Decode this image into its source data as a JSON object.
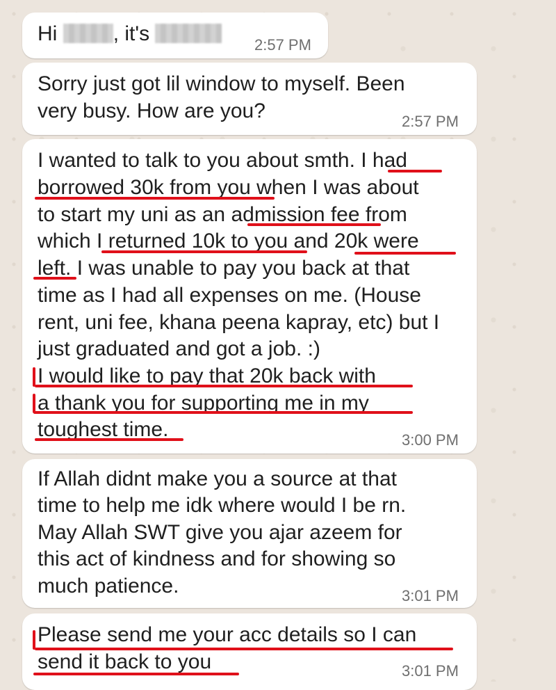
{
  "messages": [
    {
      "prefix": "Hi",
      "mid": ", it's",
      "time": "2:57 PM"
    },
    {
      "lines": [
        "Sorry just got  lil window to myself. Been",
        "very busy. How are you?"
      ],
      "time": "2:57 PM"
    },
    {
      "lines": [
        "I wanted to talk to you about smth. I had",
        "borrowed 30k from you when I was about",
        "to start my uni as an admission fee from",
        "which I returned 10k to you and 20k were",
        "left. I was unable to pay you back at that",
        "time as I had all expenses on me. (House",
        "rent, uni fee, khana peena kapray, etc) but I",
        "just graduated and got a job. :)",
        "I would like to pay that 20k back with",
        "a thank you for supporting me in my",
        "toughest time."
      ],
      "time": "3:00 PM"
    },
    {
      "lines": [
        "If Allah didnt make you a source at that",
        "time to help me idk where would I be rn.",
        "May Allah SWT give you ajar azeem for",
        "this act of kindness and for showing so",
        "much patience."
      ],
      "time": "3:01 PM"
    },
    {
      "lines": [
        "Please send me your acc details so I can",
        "send it back to you"
      ],
      "time": "3:01 PM"
    }
  ],
  "colors": {
    "background": "#ece5dd",
    "bubble": "#ffffff",
    "underline": "#e0101a",
    "timestamp": "#6f6f6f"
  }
}
